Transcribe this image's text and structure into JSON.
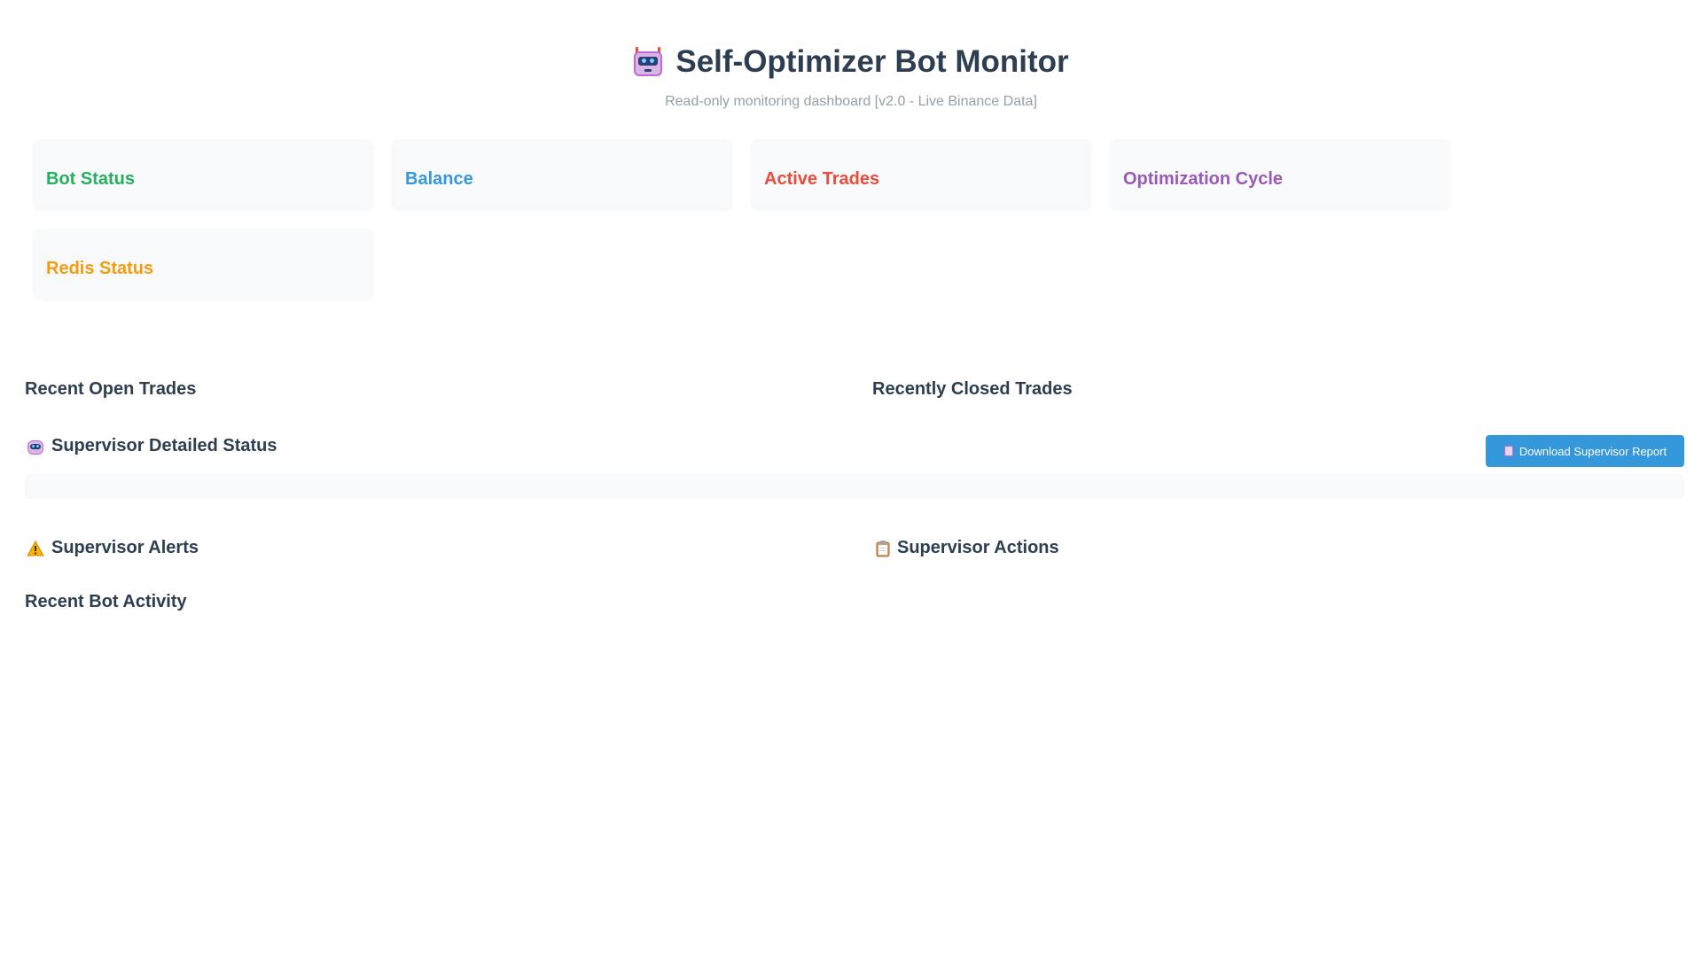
{
  "header": {
    "title": "Self-Optimizer Bot Monitor",
    "subtitle": "Read-only monitoring dashboard [v2.0 - Live Binance Data]",
    "icon": "robot-icon"
  },
  "cards": [
    {
      "label": "Bot Status",
      "color": "#27ae60"
    },
    {
      "label": "Balance",
      "color": "#3498db"
    },
    {
      "label": "Active Trades",
      "color": "#e74c3c"
    },
    {
      "label": "Optimization Cycle",
      "color": "#9b59b6"
    },
    {
      "label": "Redis Status",
      "color": "#f39c12"
    }
  ],
  "sections": {
    "open_trades": "Recent Open Trades",
    "closed_trades": "Recently Closed Trades",
    "supervisor_status": "Supervisor Detailed Status",
    "download_report": "Download Supervisor Report",
    "supervisor_alerts": "Supervisor Alerts",
    "supervisor_actions": "Supervisor Actions",
    "bot_activity": "Recent Bot Activity"
  },
  "colors": {
    "heading": "#2c3e50",
    "button": "#3498db",
    "card_bg": "#f8f9fa"
  }
}
